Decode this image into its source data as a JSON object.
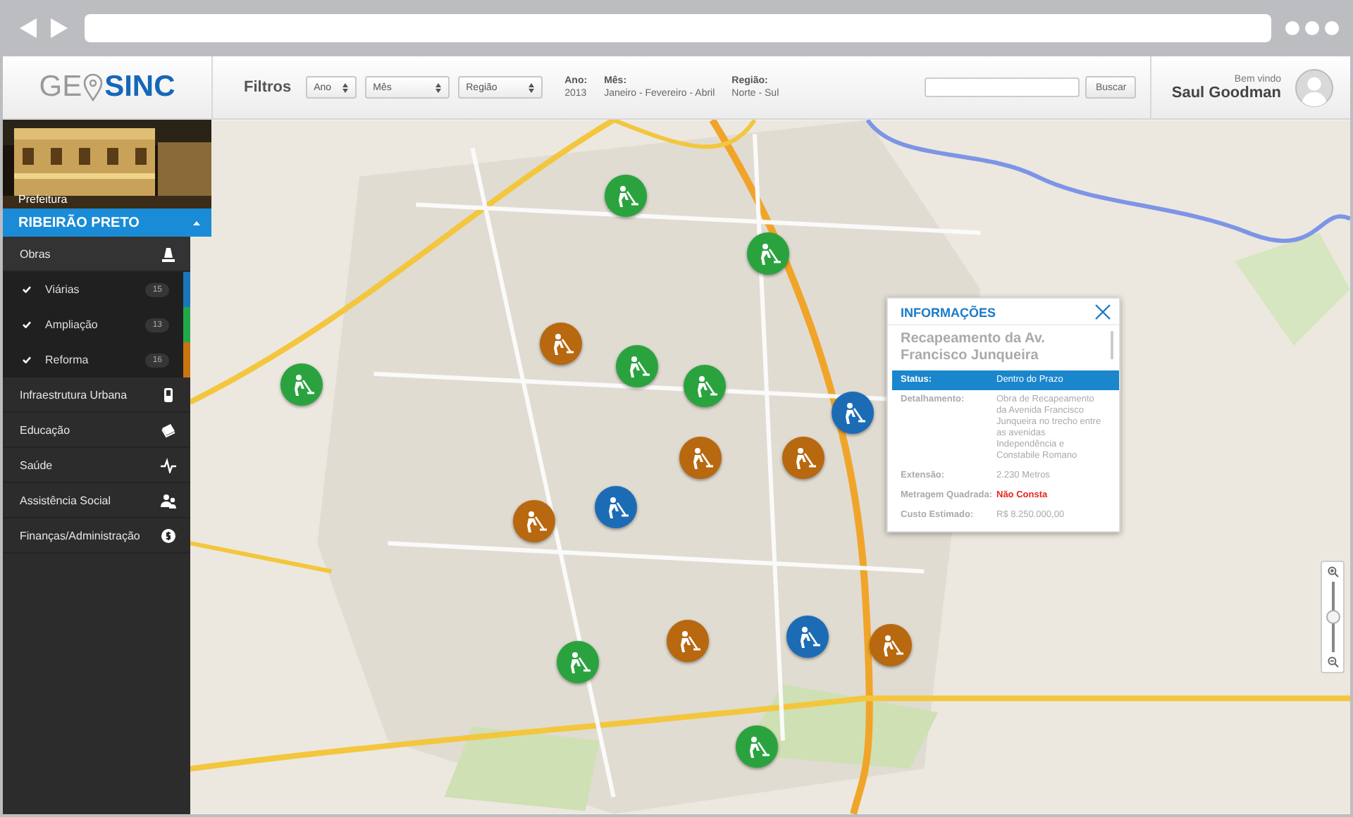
{
  "header": {
    "logo": {
      "part_1": "GE",
      "part_2": "SINC"
    },
    "filters_label": "Filtros",
    "selects": [
      {
        "label": "Ano"
      },
      {
        "label": "Mês"
      },
      {
        "label": "Região"
      }
    ],
    "summary": [
      {
        "label": "Ano:",
        "value": "2013"
      },
      {
        "label": "Mês:",
        "value": "Janeiro - Fevereiro - Abril"
      },
      {
        "label": "Região:",
        "value": "Norte - Sul"
      }
    ],
    "search_button": "Buscar",
    "user": {
      "greeting": "Bem vindo",
      "name": "Saul Goodman"
    }
  },
  "sidebar": {
    "photo_caption": "Prefeitura",
    "city": {
      "label": "RIBEIRÃO PRETO",
      "expanded": true
    },
    "items": [
      {
        "label": "Obras",
        "expanded": true,
        "children": [
          {
            "label": "Viárias",
            "count": "15",
            "checked": true,
            "color": "#1b75bb"
          },
          {
            "label": "Ampliação",
            "count": "13",
            "checked": true,
            "color": "#22a84a"
          },
          {
            "label": "Reforma",
            "count": "16",
            "checked": true,
            "color": "#c87412"
          }
        ]
      },
      {
        "label": "Infraestrutura Urbana"
      },
      {
        "label": "Educação"
      },
      {
        "label": "Saúde"
      },
      {
        "label": "Assistência Social"
      },
      {
        "label": "Finanças/Administração"
      }
    ]
  },
  "map": {
    "markers": [
      {
        "color": "#2aa33f"
      },
      {
        "color": "#2aa33f"
      },
      {
        "color": "#b8680f"
      },
      {
        "color": "#2aa33f"
      },
      {
        "color": "#2aa33f"
      },
      {
        "color": "#2aa33f"
      },
      {
        "color": "#1c6cb5"
      },
      {
        "color": "#b8680f"
      },
      {
        "color": "#b8680f"
      },
      {
        "color": "#1c6cb5"
      },
      {
        "color": "#b8680f"
      },
      {
        "color": "#1c6cb5"
      },
      {
        "color": "#b8680f"
      },
      {
        "color": "#b8680f"
      },
      {
        "color": "#2aa33f"
      },
      {
        "color": "#2aa33f"
      }
    ],
    "zoom": {
      "level": 0.5
    },
    "info_panel": {
      "title": "INFORMAÇÕES",
      "heading": "Recapeamento da Av. Francisco Junqueira",
      "rows": [
        {
          "label": "Status:",
          "value": "Dentro do Prazo",
          "highlighted": true,
          "alert": false
        },
        {
          "label": "Detalhamento:",
          "value": "Obra de Recapeamento da Avenida Francisco Junqueira no trecho entre as avenidas Independência e Constabile Romano",
          "highlighted": false,
          "alert": false
        },
        {
          "label": "Extensão:",
          "value": "2.230 Metros",
          "highlighted": false,
          "alert": false
        },
        {
          "label": "Metragem Quadrada:",
          "value": "Não Consta",
          "highlighted": false,
          "alert": true
        },
        {
          "label": "Custo Estimado:",
          "value": "R$ 8.250.000,00",
          "highlighted": false,
          "alert": false
        }
      ]
    }
  }
}
